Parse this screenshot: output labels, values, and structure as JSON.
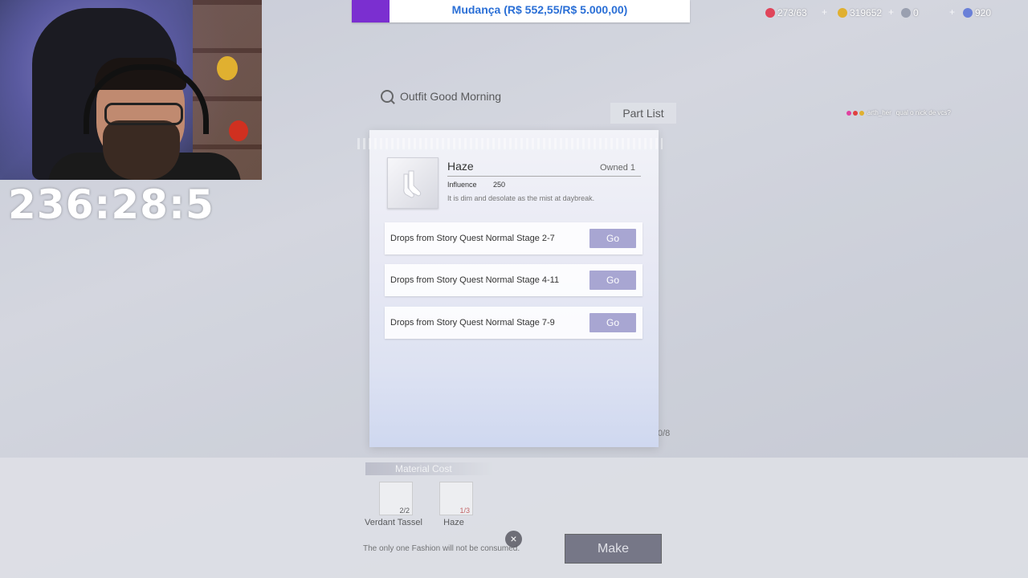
{
  "stream": {
    "timer": "236:28:5",
    "donation_text": "Mudança (R$ 552,55/R$ 5.000,00)",
    "chat_user": "arth_her",
    "chat_message": "qual o nick de vcs?",
    "colors": {
      "donation_accent": "#7b2fd0",
      "donation_text": "#2a6fd6"
    }
  },
  "resources": [
    {
      "icon": "heart-icon",
      "value": "273/63",
      "color": "#e0455a"
    },
    {
      "icon": "coin-icon",
      "value": "319652",
      "color": "#e0b030"
    },
    {
      "icon": "gem-icon",
      "value": "0",
      "color": "#9aa0b0"
    },
    {
      "icon": "diamond-icon",
      "value": "920",
      "color": "#6a80d8"
    }
  ],
  "background": {
    "search_text": "Outfit Good Morning",
    "part_list": "Part List",
    "count": "0/8",
    "material_cost_label": "Material Cost",
    "materials": [
      {
        "name": "Verdant Tassel",
        "count": "2/2"
      },
      {
        "name": "Haze",
        "count": "1/3"
      }
    ],
    "note": "The only one Fashion will not be consumed.",
    "make_label": "Make"
  },
  "modal": {
    "item_name": "Haze",
    "owned": "Owned 1",
    "influence_label": "Influence",
    "influence_value": "250",
    "description": "It is dim and desolate as the mist at daybreak.",
    "sources": [
      {
        "label": "Drops from Story Quest Normal Stage 2-7",
        "button": "Go"
      },
      {
        "label": "Drops from Story Quest Normal Stage 4-11",
        "button": "Go"
      },
      {
        "label": "Drops from Story Quest Normal Stage 7-9",
        "button": "Go"
      }
    ],
    "close_glyph": "×"
  }
}
